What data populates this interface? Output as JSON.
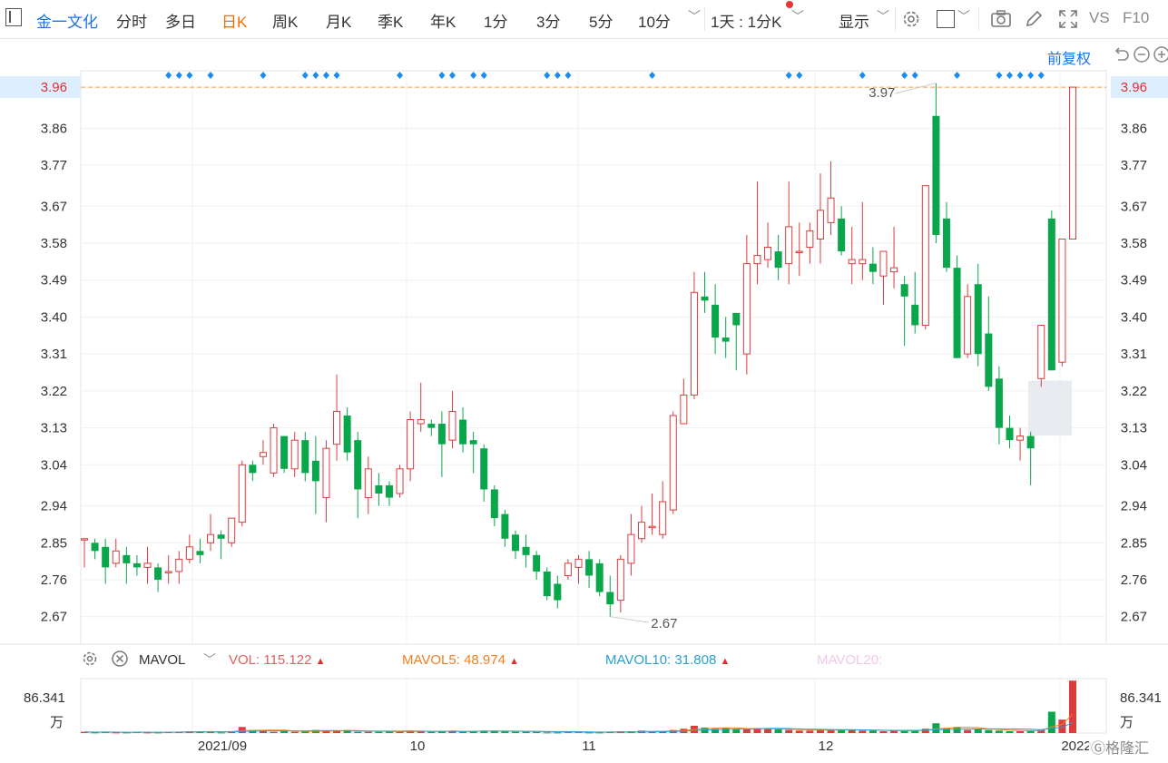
{
  "toolbar": {
    "stock_name": "金一文化",
    "items": [
      "分时",
      "多日",
      "日K",
      "周K",
      "月K",
      "季K",
      "年K",
      "1分",
      "3分",
      "5分",
      "10分"
    ],
    "active": "日K",
    "period": "1天 : 1分K",
    "display": "显示",
    "vs": "VS",
    "f10": "F10"
  },
  "adjust_label": "前复权",
  "colors": {
    "up": "#dc3c3c",
    "down": "#0aa64c",
    "accent": "#1a73e8",
    "active": "#ff6a00",
    "dashed": "#f0a040"
  },
  "icons": [
    "settings-icon",
    "close-icon",
    "camera-icon",
    "pencil-icon",
    "fullscreen-icon",
    "undo-icon",
    "zoom-out-icon",
    "zoom-in-icon"
  ],
  "price_axis": {
    "ticks": [
      "3.96",
      "3.86",
      "3.77",
      "3.67",
      "3.58",
      "3.49",
      "3.40",
      "3.31",
      "3.22",
      "3.13",
      "3.04",
      "2.94",
      "2.85",
      "2.76",
      "2.67"
    ],
    "current": "3.96"
  },
  "annotations": {
    "high": "3.97",
    "low": "2.67"
  },
  "indicator": {
    "name": "MAVOL",
    "vol": "VOL: 115.122",
    "ma5": "MAVOL5: 48.974",
    "ma10": "MAVOL10: 31.808",
    "ma20": "MAVOL20:"
  },
  "vol_axis": {
    "max": "86.341",
    "unit": "万"
  },
  "x_axis": [
    "2021/09",
    "10",
    "11",
    "12",
    "2022"
  ],
  "watermark": "格隆汇",
  "chart_data": {
    "type": "candlestick",
    "ylim": [
      2.6,
      4.0
    ],
    "candles": [
      [
        2.86,
        2.86,
        2.79,
        2.86
      ],
      [
        2.85,
        2.83,
        2.81,
        2.86
      ],
      [
        2.84,
        2.79,
        2.75,
        2.86
      ],
      [
        2.8,
        2.83,
        2.79,
        2.86
      ],
      [
        2.82,
        2.8,
        2.75,
        2.84
      ],
      [
        2.8,
        2.79,
        2.77,
        2.82
      ],
      [
        2.79,
        2.8,
        2.75,
        2.84
      ],
      [
        2.79,
        2.76,
        2.73,
        2.8
      ],
      [
        2.78,
        2.78,
        2.75,
        2.82
      ],
      [
        2.78,
        2.81,
        2.75,
        2.83
      ],
      [
        2.81,
        2.84,
        2.8,
        2.87
      ],
      [
        2.83,
        2.82,
        2.8,
        2.86
      ],
      [
        2.85,
        2.87,
        2.83,
        2.92
      ],
      [
        2.87,
        2.86,
        2.81,
        2.88
      ],
      [
        2.85,
        2.91,
        2.84,
        2.91
      ],
      [
        2.9,
        3.04,
        2.89,
        3.05
      ],
      [
        3.04,
        3.02,
        3.0,
        3.05
      ],
      [
        3.06,
        3.07,
        3.04,
        3.1
      ],
      [
        3.02,
        3.13,
        3.01,
        3.14
      ],
      [
        3.11,
        3.03,
        3.02,
        3.11
      ],
      [
        3.03,
        3.1,
        3.01,
        3.12
      ],
      [
        3.1,
        3.02,
        3.0,
        3.12
      ],
      [
        3.05,
        3.0,
        2.92,
        3.11
      ],
      [
        2.96,
        3.08,
        2.9,
        3.1
      ],
      [
        3.09,
        3.17,
        3.05,
        3.26
      ],
      [
        3.16,
        3.07,
        3.05,
        3.18
      ],
      [
        3.1,
        2.98,
        2.91,
        3.12
      ],
      [
        2.96,
        3.03,
        2.92,
        3.06
      ],
      [
        2.99,
        2.97,
        2.94,
        3.02
      ],
      [
        2.99,
        2.96,
        2.94,
        3.0
      ],
      [
        2.97,
        3.03,
        2.96,
        3.04
      ],
      [
        3.03,
        3.15,
        3.0,
        3.17
      ],
      [
        3.14,
        3.15,
        3.12,
        3.24
      ],
      [
        3.14,
        3.13,
        3.11,
        3.15
      ],
      [
        3.14,
        3.09,
        3.01,
        3.17
      ],
      [
        3.1,
        3.17,
        3.08,
        3.22
      ],
      [
        3.15,
        3.09,
        3.07,
        3.18
      ],
      [
        3.1,
        3.09,
        3.02,
        3.12
      ],
      [
        3.08,
        2.98,
        2.95,
        3.09
      ],
      [
        2.98,
        2.91,
        2.89,
        2.99
      ],
      [
        2.92,
        2.86,
        2.84,
        2.93
      ],
      [
        2.87,
        2.83,
        2.81,
        2.88
      ],
      [
        2.84,
        2.82,
        2.79,
        2.87
      ],
      [
        2.82,
        2.78,
        2.76,
        2.83
      ],
      [
        2.78,
        2.72,
        2.71,
        2.79
      ],
      [
        2.75,
        2.71,
        2.69,
        2.77
      ],
      [
        2.77,
        2.8,
        2.76,
        2.81
      ],
      [
        2.79,
        2.81,
        2.75,
        2.82
      ],
      [
        2.81,
        2.77,
        2.74,
        2.83
      ],
      [
        2.8,
        2.73,
        2.72,
        2.81
      ],
      [
        2.73,
        2.7,
        2.67,
        2.77
      ],
      [
        2.71,
        2.81,
        2.68,
        2.82
      ],
      [
        2.8,
        2.87,
        2.77,
        2.92
      ],
      [
        2.86,
        2.9,
        2.85,
        2.94
      ],
      [
        2.89,
        2.89,
        2.87,
        2.97
      ],
      [
        2.87,
        2.95,
        2.86,
        3.0
      ],
      [
        2.93,
        3.16,
        2.92,
        3.17
      ],
      [
        3.14,
        3.21,
        3.14,
        3.25
      ],
      [
        3.21,
        3.46,
        3.2,
        3.51
      ],
      [
        3.45,
        3.44,
        3.41,
        3.51
      ],
      [
        3.43,
        3.35,
        3.31,
        3.48
      ],
      [
        3.35,
        3.34,
        3.3,
        3.4
      ],
      [
        3.41,
        3.38,
        3.27,
        3.41
      ],
      [
        3.31,
        3.53,
        3.26,
        3.6
      ],
      [
        3.53,
        3.55,
        3.48,
        3.73
      ],
      [
        3.54,
        3.57,
        3.52,
        3.63
      ],
      [
        3.56,
        3.52,
        3.49,
        3.6
      ],
      [
        3.53,
        3.62,
        3.48,
        3.73
      ],
      [
        3.56,
        3.56,
        3.5,
        3.63
      ],
      [
        3.57,
        3.61,
        3.53,
        3.63
      ],
      [
        3.59,
        3.66,
        3.53,
        3.75
      ],
      [
        3.63,
        3.69,
        3.6,
        3.78
      ],
      [
        3.64,
        3.56,
        3.55,
        3.67
      ],
      [
        3.53,
        3.54,
        3.48,
        3.62
      ],
      [
        3.53,
        3.54,
        3.49,
        3.68
      ],
      [
        3.53,
        3.51,
        3.48,
        3.57
      ],
      [
        3.5,
        3.56,
        3.43,
        3.55
      ],
      [
        3.51,
        3.52,
        3.47,
        3.62
      ],
      [
        3.48,
        3.45,
        3.33,
        3.5
      ],
      [
        3.43,
        3.38,
        3.36,
        3.51
      ],
      [
        3.38,
        3.72,
        3.37,
        3.72
      ],
      [
        3.89,
        3.6,
        3.58,
        3.97
      ],
      [
        3.64,
        3.52,
        3.51,
        3.68
      ],
      [
        3.52,
        3.3,
        3.3,
        3.55
      ],
      [
        3.31,
        3.45,
        3.3,
        3.48
      ],
      [
        3.48,
        3.31,
        3.28,
        3.53
      ],
      [
        3.36,
        3.23,
        3.22,
        3.45
      ],
      [
        3.25,
        3.13,
        3.09,
        3.28
      ],
      [
        3.13,
        3.1,
        3.08,
        3.16
      ],
      [
        3.1,
        3.11,
        3.05,
        3.13
      ],
      [
        3.11,
        3.08,
        2.99,
        3.12
      ],
      [
        3.25,
        3.38,
        3.23,
        3.38
      ],
      [
        3.64,
        3.27,
        3.27,
        3.66
      ],
      [
        3.29,
        3.59,
        3.28,
        3.59
      ],
      [
        3.59,
        3.96,
        3.59,
        3.96
      ]
    ],
    "volume": [
      2,
      1,
      2,
      1,
      1,
      2,
      1,
      1,
      2,
      2,
      3,
      3,
      2,
      1,
      3,
      10,
      5,
      4,
      2,
      3,
      2,
      3,
      5,
      4,
      4,
      5,
      2,
      2,
      2,
      3,
      2,
      4,
      3,
      2,
      3,
      4,
      2,
      3,
      4,
      4,
      3,
      2,
      2,
      2,
      1,
      1,
      2,
      2,
      1,
      1,
      2,
      3,
      3,
      4,
      2,
      3,
      5,
      7,
      12,
      9,
      7,
      8,
      7,
      6,
      8,
      7,
      6,
      5,
      4,
      4,
      6,
      5,
      6,
      5,
      4,
      4,
      3,
      4,
      3,
      5,
      7,
      16,
      8,
      10,
      5,
      6,
      5,
      4,
      3,
      3,
      4,
      6,
      35,
      22,
      86
    ]
  }
}
